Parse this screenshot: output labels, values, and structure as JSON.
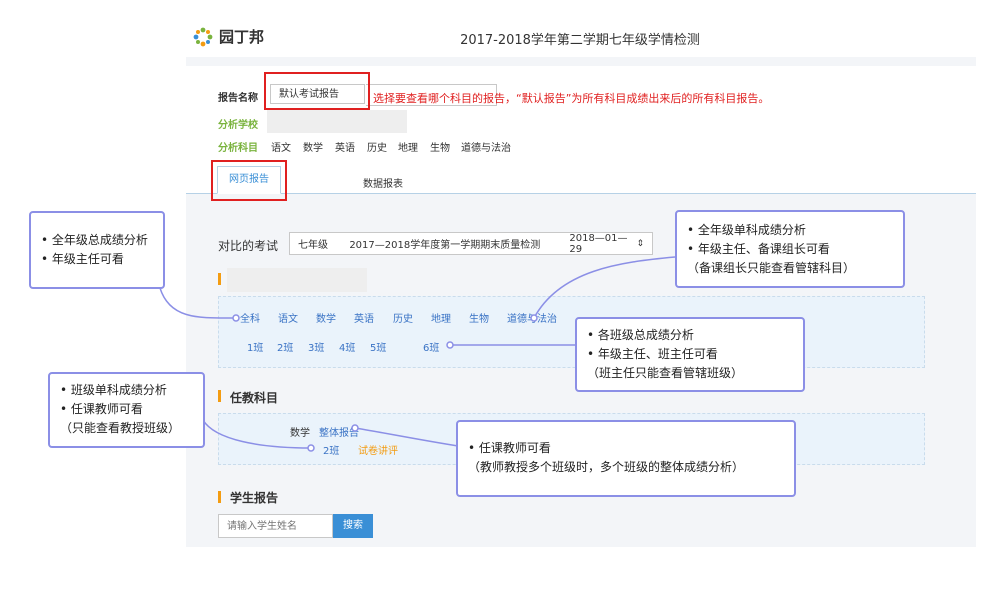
{
  "header": {
    "logo_text": "园丁邦",
    "title": "2017-2018学年第二学期七年级学情检测"
  },
  "report": {
    "name_label": "报告名称",
    "name_value": "默认考试报告",
    "hint": "选择要查看哪个科目的报告，“默认报告”为所有科目成绩出来后的所有科目报告。",
    "school_label": "分析学校",
    "subjects_label": "分析科目",
    "subjects": [
      "语文",
      "数学",
      "英语",
      "历史",
      "地理",
      "生物",
      "道德与法治"
    ]
  },
  "tabs": [
    "网页报告",
    "数据报表"
  ],
  "compare": {
    "label": "对比的考试",
    "grade": "七年级",
    "exam": "2017—2018学年度第一学期期末质量检测",
    "date": "2018—01—29"
  },
  "grade_section": {
    "subjects": [
      "全科",
      "语文",
      "数学",
      "英语",
      "历史",
      "地理",
      "生物",
      "道德与法治"
    ],
    "classes": [
      "1班",
      "2班",
      "3班",
      "4班",
      "5班",
      "6班"
    ]
  },
  "teaching": {
    "title": "任教科目",
    "subject": "数学",
    "overall_link": "整体报告",
    "class": "2班",
    "paper_link": "试卷讲评"
  },
  "student": {
    "title": "学生报告",
    "placeholder": "请输入学生姓名",
    "search": "搜索"
  },
  "callouts": {
    "grade_total": [
      "• 全年级总成绩分析",
      "• 年级主任可看"
    ],
    "grade_subject": [
      "• 全年级单科成绩分析",
      "• 年级主任、备课组长可看",
      "（备课组长只能查看管辖科目）"
    ],
    "class_total": [
      "• 各班级总成绩分析",
      "• 年级主任、班主任可看",
      "（班主任只能查看管辖班级）"
    ],
    "class_subject": [
      "• 班级单科成绩分析",
      "• 任课教师可看",
      "（只能查看教授班级）"
    ],
    "teacher": [
      "• 任课教师可看",
      "（教师教授多个班级时，多个班级的整体成绩分析）"
    ]
  }
}
